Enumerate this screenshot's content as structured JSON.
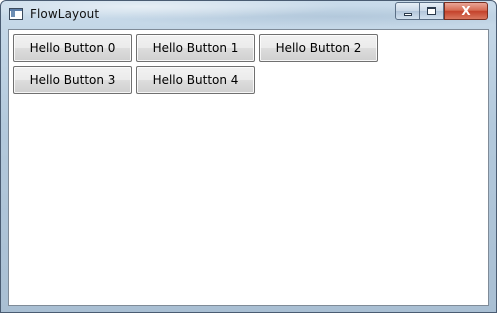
{
  "window": {
    "title": "FlowLayout",
    "icon": "window-app-icon"
  },
  "caption_buttons": {
    "minimize_icon": "minimize-icon",
    "maximize_icon": "maximize-icon",
    "close_label": "X"
  },
  "flow": {
    "buttons": [
      {
        "label": "Hello Button 0"
      },
      {
        "label": "Hello Button 1"
      },
      {
        "label": "Hello Button 2"
      },
      {
        "label": "Hello Button 3"
      },
      {
        "label": "Hello Button 4"
      }
    ]
  },
  "colors": {
    "client_background": "#ffffff",
    "close_button": "#c4422b",
    "frame": "#a9bfd3"
  }
}
